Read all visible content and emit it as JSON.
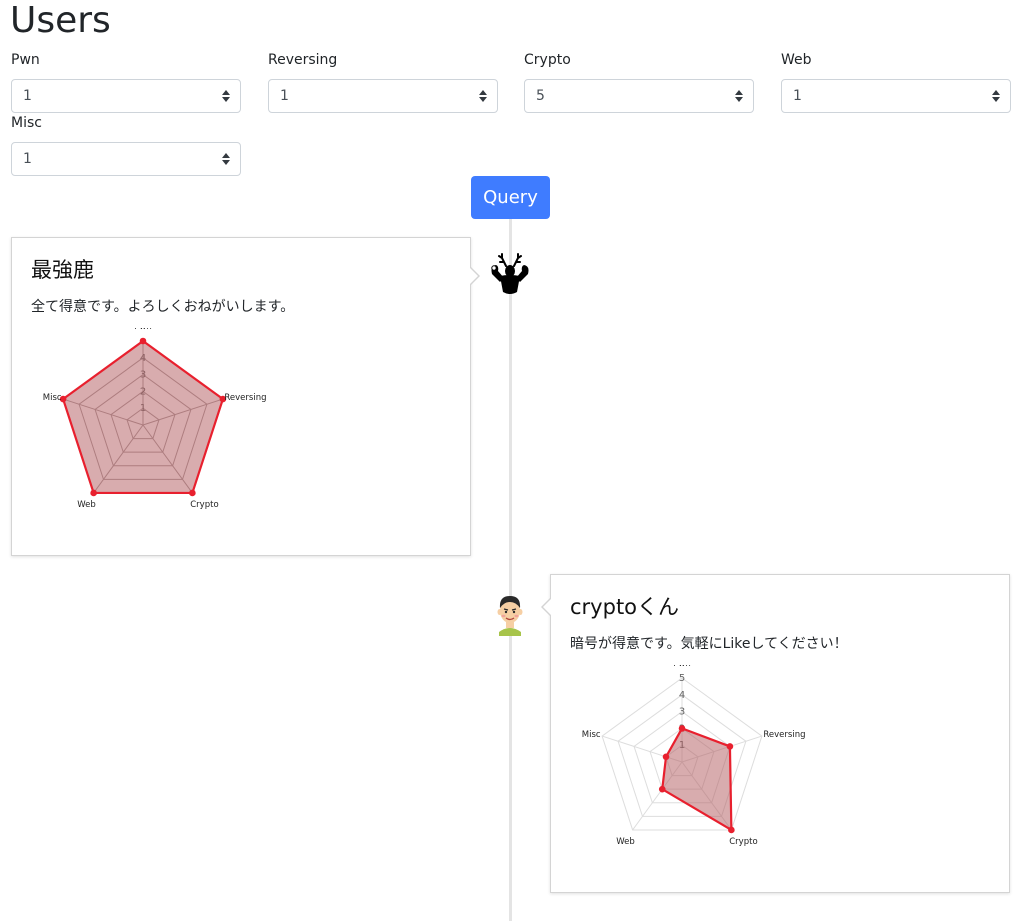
{
  "page": {
    "title": "Users"
  },
  "filters": [
    {
      "label": "Pwn",
      "value": "1"
    },
    {
      "label": "Reversing",
      "value": "1"
    },
    {
      "label": "Crypto",
      "value": "5"
    },
    {
      "label": "Web",
      "value": "1"
    },
    {
      "label": "Misc",
      "value": "1"
    }
  ],
  "query_button": {
    "label": "Query"
  },
  "colors": {
    "accent": "#3f7cff",
    "radar_stroke": "#e8202e",
    "radar_fill": "#b1595d",
    "timeline": "#e4e4e4"
  },
  "users": [
    {
      "name": "最強鹿",
      "description": "全て得意です。よろしくおねがいします。",
      "avatar_icon": "muscular-deer-icon",
      "chart_data": {
        "type": "radar",
        "axes": [
          "Pwn",
          "Reversing",
          "Crypto",
          "Web",
          "Misc"
        ],
        "values": [
          5,
          5,
          5,
          5,
          5
        ],
        "max": 5,
        "tick_labels": [
          "1",
          "2",
          "3",
          "4"
        ]
      }
    },
    {
      "name": "cryptoくん",
      "description": "暗号が得意です。気軽にLikeしてください！",
      "avatar_icon": "smiling-boy-icon",
      "chart_data": {
        "type": "radar",
        "axes": [
          "Pwn",
          "Reversing",
          "Crypto",
          "Web",
          "Misc"
        ],
        "values": [
          2,
          3,
          5,
          2,
          1
        ],
        "max": 5,
        "tick_labels": [
          "1",
          "2",
          "3",
          "4",
          "5"
        ]
      }
    }
  ]
}
